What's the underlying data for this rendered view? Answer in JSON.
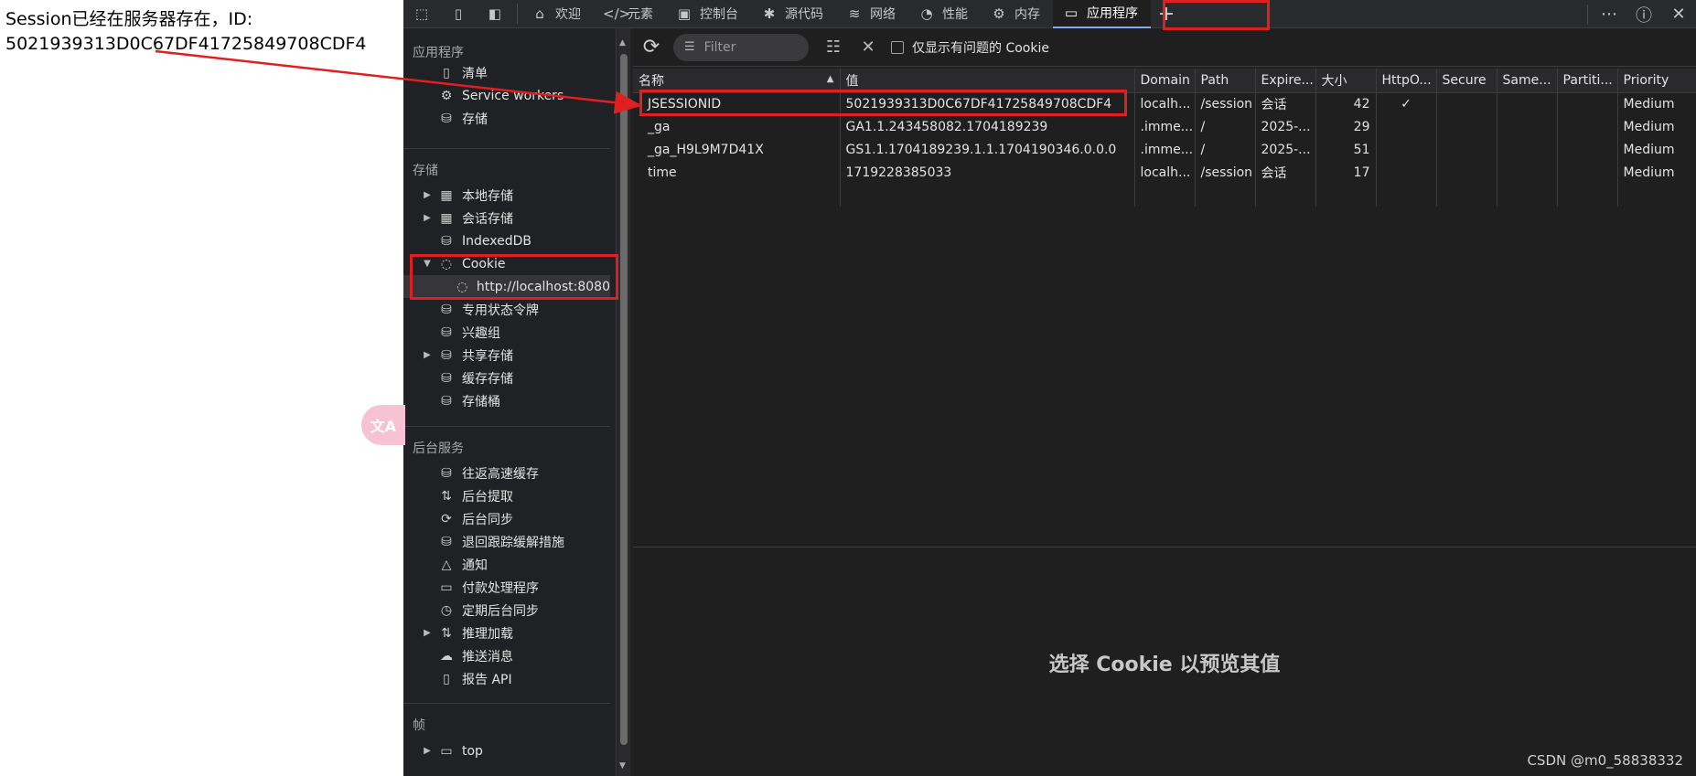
{
  "annotation": {
    "line1": "Session已经在服务器存在，ID:",
    "line2": "5021939313D0C67DF41725849708CDF4"
  },
  "translate_bubble": "文A",
  "tabbar": {
    "tabs": [
      {
        "label": "欢迎",
        "icon": "home-icon",
        "glyph": "⌂"
      },
      {
        "label": "元素",
        "icon": "code-icon",
        "glyph": "</>"
      },
      {
        "label": "控制台",
        "icon": "console-icon",
        "glyph": "▣"
      },
      {
        "label": "源代码",
        "icon": "bug-icon",
        "glyph": "✱"
      },
      {
        "label": "网络",
        "icon": "wifi-icon",
        "glyph": "≋"
      },
      {
        "label": "性能",
        "icon": "gauge-icon",
        "glyph": "◔"
      },
      {
        "label": "内存",
        "icon": "chip-icon",
        "glyph": "⚙"
      },
      {
        "label": "应用程序",
        "icon": "window-icon",
        "glyph": "▭",
        "active": true
      }
    ]
  },
  "sidebar": {
    "sections": {
      "application": "应用程序",
      "storage": "存储",
      "background": "后台服务",
      "frames": "帧"
    },
    "application_items": [
      "清单",
      "Service workers",
      "存储"
    ],
    "storage_items": [
      "本地存储",
      "会话存储",
      "IndexedDB",
      "Cookie",
      "http://localhost:8080",
      "专用状态令牌",
      "兴趣组",
      "共享存储",
      "缓存存储",
      "存储桶"
    ],
    "background_items": [
      "往返高速缓存",
      "后台提取",
      "后台同步",
      "退回跟踪缓解措施",
      "通知",
      "付款处理程序",
      "定期后台同步",
      "推理加载",
      "推送消息",
      "报告 API"
    ],
    "frame_items": [
      "top"
    ]
  },
  "toolbar": {
    "filter_placeholder": "Filter",
    "only_issues_label": "仅显示有问题的 Cookie"
  },
  "table": {
    "columns": [
      "名称",
      "值",
      "Domain",
      "Path",
      "Expire...",
      "大小",
      "HttpO...",
      "Secure",
      "Same...",
      "Partiti...",
      "Priority"
    ],
    "rows": [
      [
        "JSESSIONID",
        "5021939313D0C67DF41725849708CDF4",
        "localh...",
        "/session",
        "会话",
        "42",
        "✓",
        "",
        "",
        "",
        "Medium"
      ],
      [
        "_ga",
        "GA1.1.243458082.1704189239",
        ".imme...",
        "/",
        "2025-...",
        "29",
        "",
        "",
        "",
        "",
        "Medium"
      ],
      [
        "_ga_H9L9M7D41X",
        "GS1.1.1704189239.1.1.1704190346.0.0.0",
        ".imme...",
        "/",
        "2025-...",
        "51",
        "",
        "",
        "",
        "",
        "Medium"
      ],
      [
        "time",
        "1719228385033",
        "localh...",
        "/session",
        "会话",
        "17",
        "",
        "",
        "",
        "",
        "Medium"
      ]
    ]
  },
  "preview_text": "选择 Cookie 以预览其值",
  "watermark": "CSDN @m0_58838332",
  "colors": {
    "highlight": "#e02020",
    "active_tab_underline": "#7cacf8"
  }
}
